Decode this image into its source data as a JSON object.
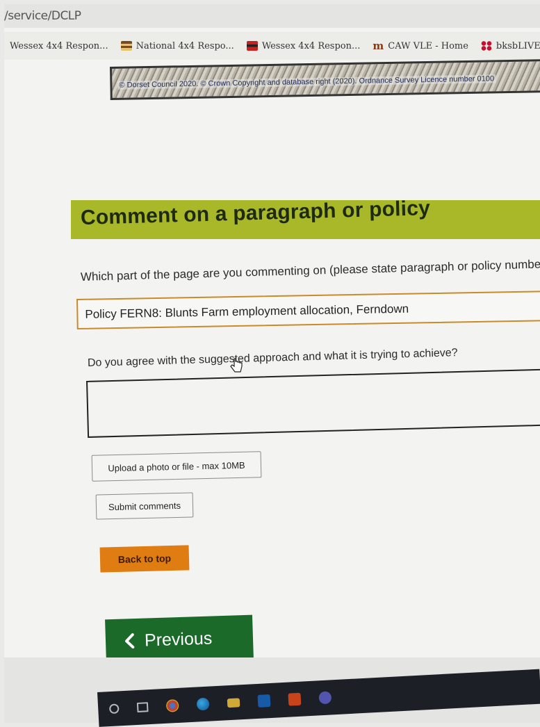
{
  "browser": {
    "address_text": "/service/DCLP",
    "bookmarks": [
      {
        "label": "Wessex 4x4 Respon...",
        "icon": "none"
      },
      {
        "label": "National 4x4 Respo...",
        "icon": "signpost-icon"
      },
      {
        "label": "Wessex 4x4 Respon...",
        "icon": "flag-icon"
      },
      {
        "label": "CAW VLE - Home",
        "icon": "m-logo-icon"
      },
      {
        "label": "bksbLIVE",
        "icon": "grid-logo-icon"
      }
    ]
  },
  "map": {
    "attribution": "© Dorset Council 2020. © Crown Copyright and database right (2020). Ordnance Survey Licence number 0100"
  },
  "section": {
    "title": "Comment on a paragraph or policy"
  },
  "form": {
    "q1_label": "Which part of the page are you commenting on (please state paragraph or policy number)",
    "q1_value": "Policy FERN8: Blunts Farm employment allocation, Ferndown",
    "q2_label": "Do you agree with the suggested approach and what it is trying to achieve?",
    "q2_value": "",
    "upload_label": "Upload a photo or file - max 10MB",
    "submit_label": "Submit comments"
  },
  "nav": {
    "back_to_top_label": "Back to top",
    "previous_label": "Previous"
  },
  "colors": {
    "header_bg": "#a8b828",
    "back_to_top_bg": "#e07d12",
    "previous_bg": "#1c6a2a",
    "field_border": "#c98a2a"
  },
  "taskbar": {
    "icons": [
      "search-icon",
      "task-view-icon",
      "chrome-icon",
      "edge-icon",
      "file-explorer-icon",
      "outlook-icon",
      "office-icon",
      "teams-icon"
    ]
  }
}
